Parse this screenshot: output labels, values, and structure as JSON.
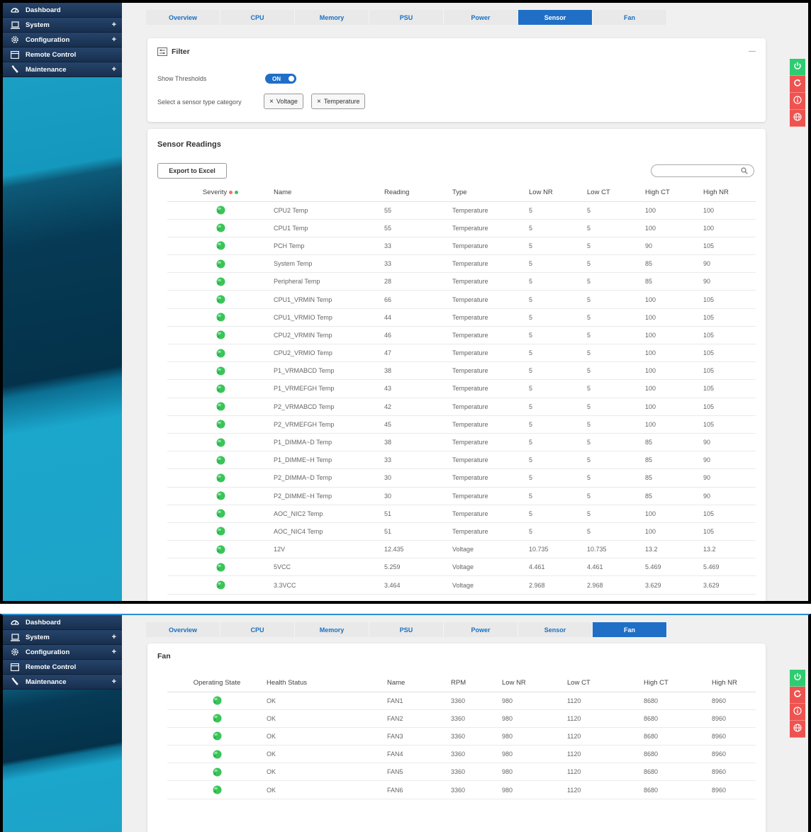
{
  "sidebar": {
    "items": [
      {
        "label": "Dashboard",
        "icon": "dashboard-icon",
        "expandable": false
      },
      {
        "label": "System",
        "icon": "laptop-icon",
        "expandable": true
      },
      {
        "label": "Configuration",
        "icon": "gear-icon",
        "expandable": true
      },
      {
        "label": "Remote Control",
        "icon": "window-icon",
        "expandable": false
      },
      {
        "label": "Maintenance",
        "icon": "wrench-icon",
        "expandable": true
      }
    ],
    "plus": "+"
  },
  "tabs": [
    "Overview",
    "CPU",
    "Memory",
    "PSU",
    "Power",
    "Sensor",
    "Fan"
  ],
  "filter": {
    "title": "Filter",
    "collapse": "—",
    "show_thresholds_label": "Show Thresholds",
    "toggle_label": "ON",
    "category_label": "Select a sensor type category",
    "chips": [
      "Voltage",
      "Temperature"
    ],
    "chip_x": "×"
  },
  "readings": {
    "title": "Sensor Readings",
    "export_label": "Export to Excel",
    "search_value": "",
    "columns": [
      "Severity",
      "Name",
      "Reading",
      "Type",
      "Low NR",
      "Low CT",
      "High CT",
      "High NR"
    ],
    "rows": [
      [
        "CPU2 Temp",
        "55",
        "Temperature",
        "5",
        "5",
        "100",
        "100"
      ],
      [
        "CPU1 Temp",
        "55",
        "Temperature",
        "5",
        "5",
        "100",
        "100"
      ],
      [
        "PCH Temp",
        "33",
        "Temperature",
        "5",
        "5",
        "90",
        "105"
      ],
      [
        "System Temp",
        "33",
        "Temperature",
        "5",
        "5",
        "85",
        "90"
      ],
      [
        "Peripheral Temp",
        "28",
        "Temperature",
        "5",
        "5",
        "85",
        "90"
      ],
      [
        "CPU1_VRMIN Temp",
        "66",
        "Temperature",
        "5",
        "5",
        "100",
        "105"
      ],
      [
        "CPU1_VRMIO Temp",
        "44",
        "Temperature",
        "5",
        "5",
        "100",
        "105"
      ],
      [
        "CPU2_VRMIN Temp",
        "46",
        "Temperature",
        "5",
        "5",
        "100",
        "105"
      ],
      [
        "CPU2_VRMIO Temp",
        "47",
        "Temperature",
        "5",
        "5",
        "100",
        "105"
      ],
      [
        "P1_VRMABCD Temp",
        "38",
        "Temperature",
        "5",
        "5",
        "100",
        "105"
      ],
      [
        "P1_VRMEFGH Temp",
        "43",
        "Temperature",
        "5",
        "5",
        "100",
        "105"
      ],
      [
        "P2_VRMABCD Temp",
        "42",
        "Temperature",
        "5",
        "5",
        "100",
        "105"
      ],
      [
        "P2_VRMEFGH Temp",
        "45",
        "Temperature",
        "5",
        "5",
        "100",
        "105"
      ],
      [
        "P1_DIMMA~D Temp",
        "38",
        "Temperature",
        "5",
        "5",
        "85",
        "90"
      ],
      [
        "P1_DIMME~H Temp",
        "33",
        "Temperature",
        "5",
        "5",
        "85",
        "90"
      ],
      [
        "P2_DIMMA~D Temp",
        "30",
        "Temperature",
        "5",
        "5",
        "85",
        "90"
      ],
      [
        "P2_DIMME~H Temp",
        "30",
        "Temperature",
        "5",
        "5",
        "85",
        "90"
      ],
      [
        "AOC_NIC2 Temp",
        "51",
        "Temperature",
        "5",
        "5",
        "100",
        "105"
      ],
      [
        "AOC_NIC4 Temp",
        "51",
        "Temperature",
        "5",
        "5",
        "100",
        "105"
      ],
      [
        "12V",
        "12.435",
        "Voltage",
        "10.735",
        "10.735",
        "13.2",
        "13.2"
      ],
      [
        "5VCC",
        "5.259",
        "Voltage",
        "4.461",
        "4.461",
        "5.469",
        "5.469"
      ],
      [
        "3.3VCC",
        "3.464",
        "Voltage",
        "2.968",
        "2.968",
        "3.629",
        "3.629"
      ]
    ]
  },
  "fan": {
    "title": "Fan",
    "columns": [
      "Operating State",
      "Health Status",
      "Name",
      "RPM",
      "Low NR",
      "Low CT",
      "High CT",
      "High NR"
    ],
    "rows": [
      [
        "OK",
        "FAN1",
        "3360",
        "980",
        "1120",
        "8680",
        "8960"
      ],
      [
        "OK",
        "FAN2",
        "3360",
        "980",
        "1120",
        "8680",
        "8960"
      ],
      [
        "OK",
        "FAN3",
        "3360",
        "980",
        "1120",
        "8680",
        "8960"
      ],
      [
        "OK",
        "FAN4",
        "3360",
        "980",
        "1120",
        "8680",
        "8960"
      ],
      [
        "OK",
        "FAN5",
        "3360",
        "980",
        "1120",
        "8680",
        "8960"
      ],
      [
        "OK",
        "FAN6",
        "3360",
        "980",
        "1120",
        "8680",
        "8960"
      ]
    ]
  },
  "side_buttons": [
    {
      "icon": "power-icon",
      "color": "#2ecc71"
    },
    {
      "icon": "refresh-icon",
      "color": "#ef5350"
    },
    {
      "icon": "info-icon",
      "color": "#ef5350"
    },
    {
      "icon": "globe-icon",
      "color": "#ef5350"
    }
  ],
  "colors": {
    "accent": "#1f6fc7",
    "ok": "#3bc45a",
    "warn_dot": "#ff6b6b"
  }
}
